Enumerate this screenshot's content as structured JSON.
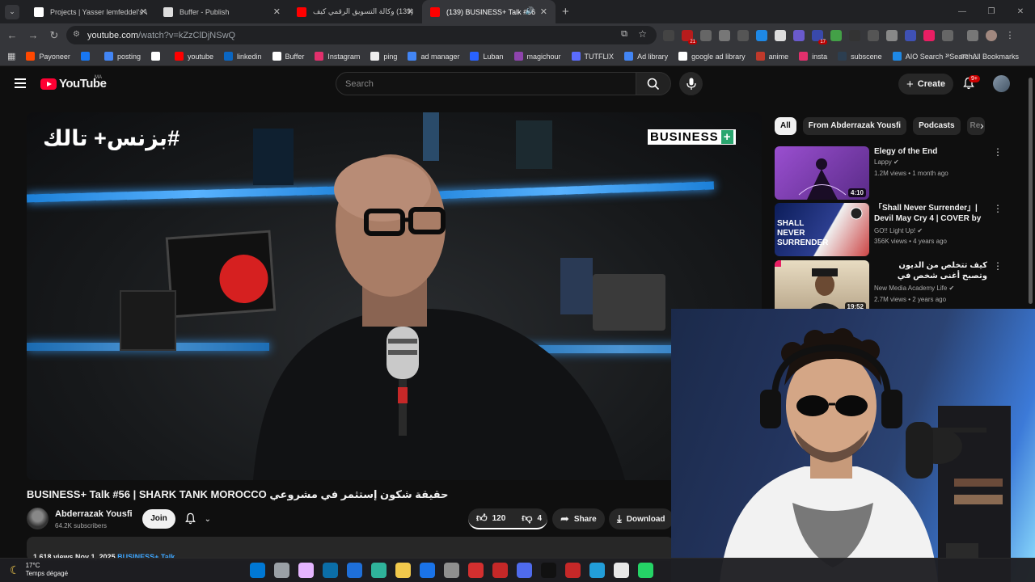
{
  "browser": {
    "tabs": [
      {
        "title": "Projects | Yasser lemfeddel's W",
        "fav_color": "#ffffff",
        "active": false
      },
      {
        "title": "Buffer - Publish",
        "fav_color": "#ffffff",
        "active": false
      },
      {
        "title": "(139) وكالة التسويق الرقمي كيف",
        "fav_color": "#ff0000",
        "active": false
      },
      {
        "title": "(139) BUSINESS+ Talk #56 |",
        "fav_color": "#ff0000",
        "active": true
      }
    ],
    "new_tab": "+",
    "url_host": "youtube.com",
    "url_rest": "/watch?v=kZzClDjNSwQ",
    "bookmarks": [
      {
        "label": "Payoneer",
        "color": "#ff4800"
      },
      {
        "label": "",
        "color": "#1877f2"
      },
      {
        "label": "posting",
        "color": "#4285f4"
      },
      {
        "label": "",
        "color": "#ffffff"
      },
      {
        "label": "youtube",
        "color": "#ff0000"
      },
      {
        "label": "linkedin",
        "color": "#0a66c2"
      },
      {
        "label": "Buffer",
        "color": "#ffffff"
      },
      {
        "label": "Instagram",
        "color": "#e1306c"
      },
      {
        "label": "ping",
        "color": "#eeeeee"
      },
      {
        "label": "ad manager",
        "color": "#4285f4"
      },
      {
        "label": "Luban",
        "color": "#2962ff"
      },
      {
        "label": "magichour",
        "color": "#8e44ad"
      },
      {
        "label": "TUTFLIX",
        "color": "#5b6cff"
      },
      {
        "label": "Ad library",
        "color": "#4285f4"
      },
      {
        "label": "google ad library",
        "color": "#ffffff"
      },
      {
        "label": "anime",
        "color": "#c0392b"
      },
      {
        "label": "insta",
        "color": "#e1306c"
      },
      {
        "label": "subscene",
        "color": "#2c3e50"
      },
      {
        "label": "AIO Search - Search...",
        "color": "#1e88e5"
      }
    ],
    "all_bookmarks": "All Bookmarks",
    "ext_badges": {
      "badge1": "21",
      "badge2": "17"
    }
  },
  "yt": {
    "logo_text": "YouTube",
    "country": "MA",
    "search_placeholder": "Search",
    "create_label": "Create",
    "notif_count": "9+",
    "video": {
      "overlay_title": "#بزنس+ تالك",
      "overlay_brand": "BUSINESS",
      "overlay_brand_plus": "+",
      "title": "BUSINESS+ Talk #56 | SHARK TANK MOROCCO حقيقة شكون إستثمر في مشروعي",
      "channel": "Abderrazak Yousfi",
      "subscribers": "64.2K subscribers",
      "join": "Join",
      "likes": "120",
      "dislikes": "4",
      "share": "Share",
      "download": "Download",
      "meta_views": "1,618 views  Nov 1, 2025",
      "meta_tag": "BUSINESS+ Talk"
    },
    "chips": [
      "All",
      "From Abderrazak Yousfi",
      "Podcasts",
      "Re"
    ],
    "recommendations": [
      {
        "title": "Elegy of the End",
        "channel": "Lappy",
        "stats": "1.2M views • 1 month ago",
        "duration": "4:10",
        "thumb": "#7b3fa8"
      },
      {
        "title": "「Shall Never Surrender」| Devil May Cry 4 | COVER by G...",
        "channel": "GO!! Light Up!",
        "stats": "356K views • 4 years ago",
        "duration": "",
        "thumb": "#1a2f7a"
      },
      {
        "title": "كيف تتخلص من الديون وتصبح أغنى شخص في العالم؟ | بركفيين",
        "channel": "New Media Academy Life",
        "stats": "2.7M views • 2 years ago",
        "duration": "19:52",
        "thumb": "#d9c7a0"
      }
    ]
  },
  "taskbar": {
    "temp": "17°C",
    "weather": "Temps dégagé",
    "apps": [
      "#0078d4",
      "#9aa0a6",
      "#e5b5ff",
      "#0b6ea8",
      "#1e6fd9",
      "#2fb39b",
      "#f2c94c",
      "#1a73e8",
      "#8f8f8f",
      "#d32f2f",
      "#c62828",
      "#4f6bed",
      "#111111",
      "#c62828",
      "#229ed9",
      "#e8e8e8",
      "#25d366"
    ]
  }
}
